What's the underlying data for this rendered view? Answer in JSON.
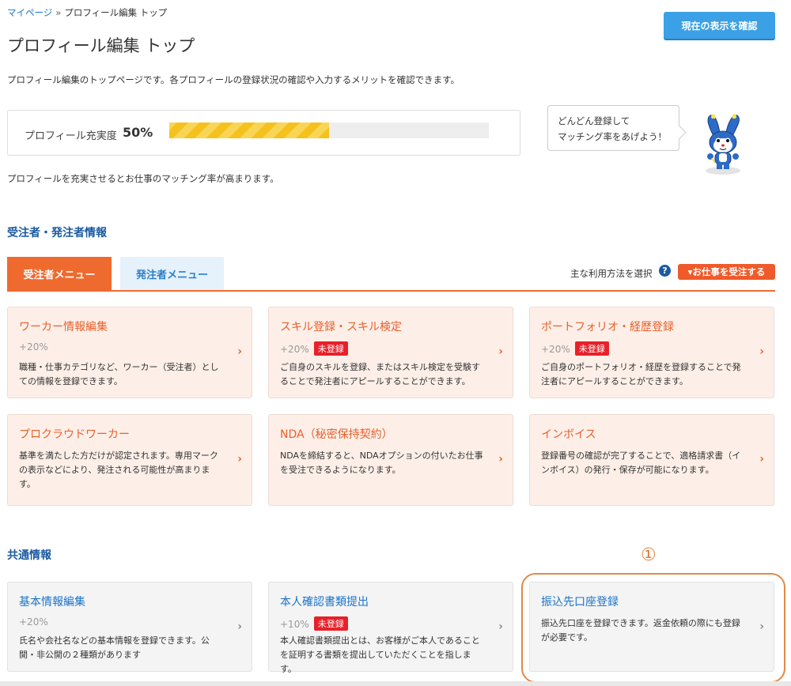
{
  "breadcrumb": {
    "home": "マイページ",
    "separator": "»",
    "current": "プロフィール編集 トップ"
  },
  "confirm_button": "現在の表示を確認",
  "page_title": "プロフィール編集 トップ",
  "page_desc": "プロフィール編集のトップページです。各プロフィールの登録状況の確認や入力するメリットを確認できます。",
  "progress": {
    "label": "プロフィール充実度",
    "value_text": "50%",
    "value": 0.5
  },
  "bubble": {
    "line1": "どんどん登録して",
    "line2": "マッチング率をあげよう！"
  },
  "match_note": "プロフィールを充実させるとお仕事のマッチング率が高まります。",
  "sections": {
    "worker_client": "受注者・発注者情報",
    "common": "共通情報"
  },
  "tabs": {
    "worker": "受注者メニュー",
    "client": "発注者メニュー"
  },
  "usage": {
    "label": "主な利用方法を選択",
    "help": "?",
    "button": "▾お仕事を受注する"
  },
  "badge_unregistered": "未登録",
  "chevron": "›",
  "worker_cards": [
    {
      "title": "ワーカー情報編集",
      "pct": "+20%",
      "desc": "職種・仕事カテゴリなど、ワーカー（受注者）としての情報を登録できます。"
    },
    {
      "title": "スキル登録・スキル検定",
      "pct": "+20%",
      "desc": "ご自身のスキルを登録、またはスキル検定を受験することで発注者にアピールすることができます。"
    },
    {
      "title": "ポートフォリオ・経歴登録",
      "pct": "+20%",
      "desc": "ご自身のポートフォリオ・経歴を登録することで発注者にアピールすることができます。"
    },
    {
      "title": "プロクラウドワーカー",
      "desc": "基準を満たした方だけが認定されます。専用マークの表示などにより、発注される可能性が高まります。"
    },
    {
      "title": "NDA（秘密保持契約）",
      "desc": "NDAを締結すると、NDAオプションの付いたお仕事を受注できるようになります。"
    },
    {
      "title": "インボイス",
      "desc": "登録番号の確認が完了することで、適格請求書（インボイス）の発行・保存が可能になります。"
    }
  ],
  "common_cards": [
    {
      "title": "基本情報編集",
      "pct": "+20%",
      "desc": "氏名や会社名などの基本情報を登録できます。公開・非公開の２種類があります"
    },
    {
      "title": "本人確認書類提出",
      "pct": "+10%",
      "desc": "本人確認書類提出とは、お客様がご本人であることを証明する書類を提出していただくことを指します。"
    },
    {
      "title": "振込先口座登録",
      "desc": "振込先口座を登録できます。返金依頼の際にも登録が必要です。"
    }
  ],
  "annotation_number": "①"
}
